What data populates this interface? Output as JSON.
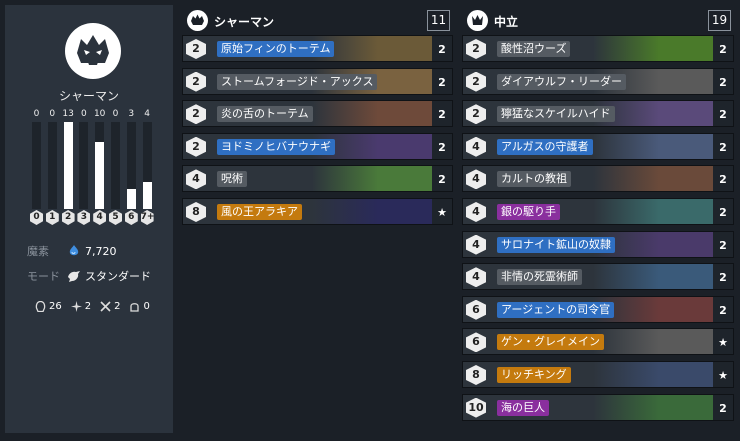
{
  "sidebar": {
    "class_name": "シャーマン",
    "mana_curve": [
      {
        "cost": "0",
        "count": 0
      },
      {
        "cost": "1",
        "count": 0
      },
      {
        "cost": "2",
        "count": 13
      },
      {
        "cost": "3",
        "count": 0
      },
      {
        "cost": "4",
        "count": 10
      },
      {
        "cost": "5",
        "count": 0
      },
      {
        "cost": "6",
        "count": 3
      },
      {
        "cost": "7+",
        "count": 4
      }
    ],
    "dust_label": "魔素",
    "dust_value": "7,720",
    "mode_label": "モード",
    "mode_value": "スタンダード",
    "type_counts": [
      {
        "icon": "minion-icon",
        "value": "26"
      },
      {
        "icon": "spell-icon",
        "value": "2"
      },
      {
        "icon": "weapon-icon",
        "value": "2"
      },
      {
        "icon": "hero-icon",
        "value": "0"
      }
    ]
  },
  "class_panel": {
    "title": "シャーマン",
    "total": "11",
    "cards": [
      {
        "cost": "2",
        "name": "原始フィンのトーテム",
        "qty": "2",
        "rarity": "rare",
        "art": "#6b5a38"
      },
      {
        "cost": "2",
        "name": "ストームフォージド・アックス",
        "qty": "2",
        "rarity": "common",
        "art": "#7a6240"
      },
      {
        "cost": "2",
        "name": "炎の舌のトーテム",
        "qty": "2",
        "rarity": "free",
        "art": "#6e4a3a"
      },
      {
        "cost": "2",
        "name": "ヨドミノヒバナウナギ",
        "qty": "2",
        "rarity": "rare",
        "art": "#4a3a6e"
      },
      {
        "cost": "4",
        "name": "呪術",
        "qty": "2",
        "rarity": "free",
        "art": "#4a7a3a"
      },
      {
        "cost": "8",
        "name": "風の王アラキア",
        "qty": "★",
        "rarity": "legendary",
        "art": "#2a2a5a"
      }
    ]
  },
  "neutral_panel": {
    "title": "中立",
    "total": "19",
    "cards": [
      {
        "cost": "2",
        "name": "酸性沼ウーズ",
        "qty": "2",
        "rarity": "free",
        "art": "#4a7a2a"
      },
      {
        "cost": "2",
        "name": "ダイアウルフ・リーダー",
        "qty": "2",
        "rarity": "free",
        "art": "#5a5a5a"
      },
      {
        "cost": "2",
        "name": "獰猛なスケイルハイド",
        "qty": "2",
        "rarity": "free",
        "art": "#5a4a7a"
      },
      {
        "cost": "4",
        "name": "アルガスの守護者",
        "qty": "2",
        "rarity": "rare",
        "art": "#4a5a7a"
      },
      {
        "cost": "4",
        "name": "カルトの教祖",
        "qty": "2",
        "rarity": "free",
        "art": "#6a4a3a"
      },
      {
        "cost": "4",
        "name": "銀の駆り手",
        "qty": "2",
        "rarity": "epic",
        "art": "#3a6a6a"
      },
      {
        "cost": "4",
        "name": "サロナイト鉱山の奴隷",
        "qty": "2",
        "rarity": "rare",
        "art": "#4a3a6a"
      },
      {
        "cost": "4",
        "name": "非情の死霊術師",
        "qty": "2",
        "rarity": "free",
        "art": "#3a5a7a"
      },
      {
        "cost": "6",
        "name": "アージェントの司令官",
        "qty": "2",
        "rarity": "rare",
        "art": "#6a3a3a"
      },
      {
        "cost": "6",
        "name": "ゲン・グレイメイン",
        "qty": "★",
        "rarity": "legendary",
        "art": "#5a5a5a"
      },
      {
        "cost": "8",
        "name": "リッチキング",
        "qty": "★",
        "rarity": "legendary",
        "art": "#3a4a6a"
      },
      {
        "cost": "10",
        "name": "海の巨人",
        "qty": "2",
        "rarity": "epic",
        "art": "#3a6a3a"
      }
    ]
  },
  "colors": {
    "rare": "#2f6fc2",
    "epic": "#8a2f9e",
    "legendary": "#c47a0e",
    "common": "#555b62",
    "free": "#555b62"
  }
}
